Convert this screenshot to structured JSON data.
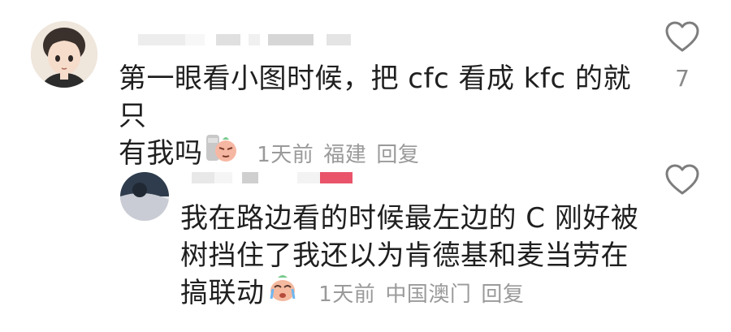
{
  "comments": [
    {
      "text_lines": [
        "第一眼看小图时候，把 cfc 看成 kfc 的就只",
        "有我吗"
      ],
      "meta": {
        "time": "1天前",
        "location": "福建",
        "reply": "回复"
      },
      "likes": "7"
    },
    {
      "text_lines": [
        "我在路边看的时候最左边的 C 刚好被",
        "树挡住了我还以为肯德基和麦当劳在",
        "搞联动"
      ],
      "meta": {
        "time": "1天前",
        "location": "中国澳门",
        "reply": "回复"
      },
      "likes": ""
    }
  ],
  "icons": {
    "like": "heart-outline-icon",
    "sticker_1": "sly-face-sticker-icon",
    "sticker_2": "crying-face-sticker-icon"
  },
  "colors": {
    "text": "#1f1f1f",
    "meta": "#9a9a9a",
    "username_highlight": "#e9546b"
  }
}
